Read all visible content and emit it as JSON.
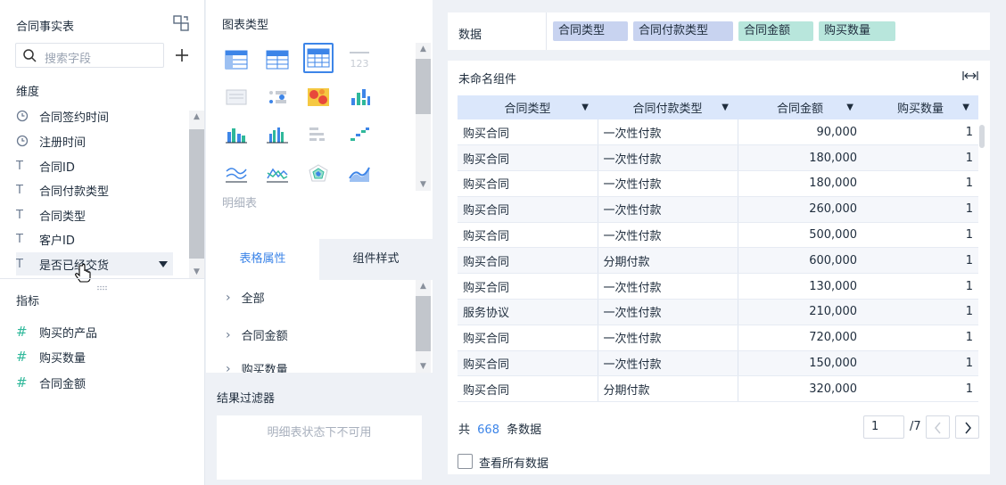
{
  "left_panel": {
    "title": "合同事实表",
    "search_placeholder": "搜索字段",
    "dimensions_title": "维度",
    "dimensions": [
      {
        "icon": "clock-icon",
        "label": "合同签约时间"
      },
      {
        "icon": "clock-icon",
        "label": "注册时间"
      },
      {
        "icon": "text-type-icon",
        "label": "合同ID"
      },
      {
        "icon": "text-type-icon",
        "label": "合同付款类型"
      },
      {
        "icon": "text-type-icon",
        "label": "合同类型"
      },
      {
        "icon": "text-type-icon",
        "label": "客户ID"
      },
      {
        "icon": "text-type-icon",
        "label": "是否已经交货"
      }
    ],
    "measures_title": "指标",
    "measures": [
      {
        "icon": "hash-icon",
        "label": "购买的产品"
      },
      {
        "icon": "hash-icon",
        "label": "购买数量"
      },
      {
        "icon": "hash-icon",
        "label": "合同金额"
      }
    ]
  },
  "middle_panel": {
    "chart_types_title": "图表类型",
    "selected_type_label": "明细表",
    "tabs": [
      "表格属性",
      "组件样式"
    ],
    "properties": [
      "全部",
      "合同金额",
      "购买数量"
    ],
    "filter_title": "结果过滤器",
    "filter_disabled_text": "明细表状态下不可用"
  },
  "right_panel": {
    "data_label": "数据",
    "data_chips": [
      {
        "label": "合同类型",
        "color": "#c8d3f0"
      },
      {
        "label": "合同付款类型",
        "color": "#c8d3f0"
      },
      {
        "label": "合同金额",
        "color": "#b8e6dc"
      },
      {
        "label": "购买数量",
        "color": "#b8e6dc"
      }
    ],
    "widget_title": "未命名组件",
    "columns": [
      "合同类型",
      "合同付款类型",
      "合同金额",
      "购买数量"
    ],
    "rows": [
      [
        "购买合同",
        "一次性付款",
        "90,000",
        "1"
      ],
      [
        "购买合同",
        "一次性付款",
        "180,000",
        "1"
      ],
      [
        "购买合同",
        "一次性付款",
        "180,000",
        "1"
      ],
      [
        "购买合同",
        "一次性付款",
        "260,000",
        "1"
      ],
      [
        "购买合同",
        "一次性付款",
        "500,000",
        "1"
      ],
      [
        "购买合同",
        "分期付款",
        "600,000",
        "1"
      ],
      [
        "购买合同",
        "一次性付款",
        "130,000",
        "1"
      ],
      [
        "服务协议",
        "一次性付款",
        "210,000",
        "1"
      ],
      [
        "购买合同",
        "一次性付款",
        "720,000",
        "1"
      ],
      [
        "购买合同",
        "一次性付款",
        "150,000",
        "1"
      ],
      [
        "购买合同",
        "分期付款",
        "320,000",
        "1"
      ]
    ],
    "footer": {
      "total_prefix": "共",
      "total_count": "668",
      "total_suffix": "条数据",
      "page_current": "1",
      "page_total": "/7",
      "view_all_label": "查看所有数据"
    }
  },
  "colors": {
    "accent": "#3d85e8",
    "header_bg": "#dbe7fb",
    "dim_chip": "#c8d3f0",
    "measure_chip": "#b8e6dc"
  }
}
